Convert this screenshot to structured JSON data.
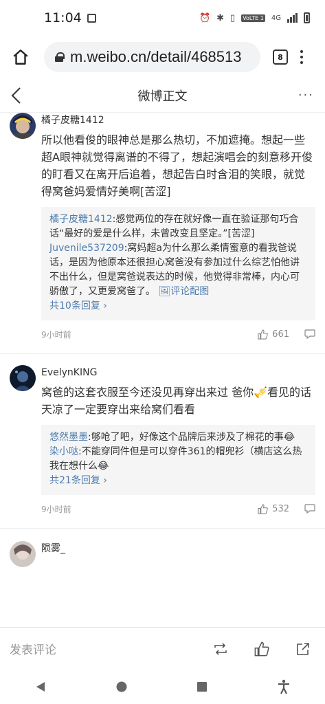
{
  "status": {
    "time": "11:04",
    "network": "4G",
    "volte": "VoLTE 1"
  },
  "browser": {
    "url": "m.weibo.cn/detail/468513",
    "tab_count": "8"
  },
  "header": {
    "title": "微博正文",
    "more": "···"
  },
  "comments": [
    {
      "user": "橘子皮糖1412",
      "text": "所以他看俊的眼神总是那么热切，不加遮掩。想起一些超A眼神就觉得离谱的不得了，想起演唱会的刻意移开俊的盯看又在离开后追着，想起告白时含泪的笑眼，就觉得窝爸妈爱情好美啊[苦涩]",
      "replies": [
        {
          "name": "橘子皮糖1412",
          "text": ":感觉两位的存在就好像一直在验证那句巧合话“最好的爱是什么样，未曾改变且坚定。”[苦涩]"
        },
        {
          "name": "Juvenile537209",
          "text": ":窝妈超a为什么那么柔情蜜意的看我爸说话，是因为他原本还很担心窝爸没有参加过什么综艺怕他讲不出什么，但是窝爸说表达的时候，他觉得非常棒，内心可骄傲了，又更爱窝爸了。",
          "link": "评论配图"
        }
      ],
      "more_replies": "共10条回复",
      "time": "9小时前",
      "likes": "661"
    },
    {
      "user": "EvelynKING",
      "text": "窝爸的这套衣服至今还没见再穿出来过 爸你🎺看见的话天凉了一定要穿出来给窝们看看",
      "replies": [
        {
          "name": "悠然墨墨",
          "text": ":够呛了吧，好像这个品牌后来涉及了棉花的事😂"
        },
        {
          "name": "染小哒",
          "text": ":不能穿同件但是可以穿件361的帽兜衫（横店这么热我在想什么😂"
        }
      ],
      "more_replies": "共21条回复",
      "time": "9小时前",
      "likes": "532"
    },
    {
      "user": "陨雾_"
    }
  ],
  "bottom": {
    "placeholder": "发表评论"
  }
}
